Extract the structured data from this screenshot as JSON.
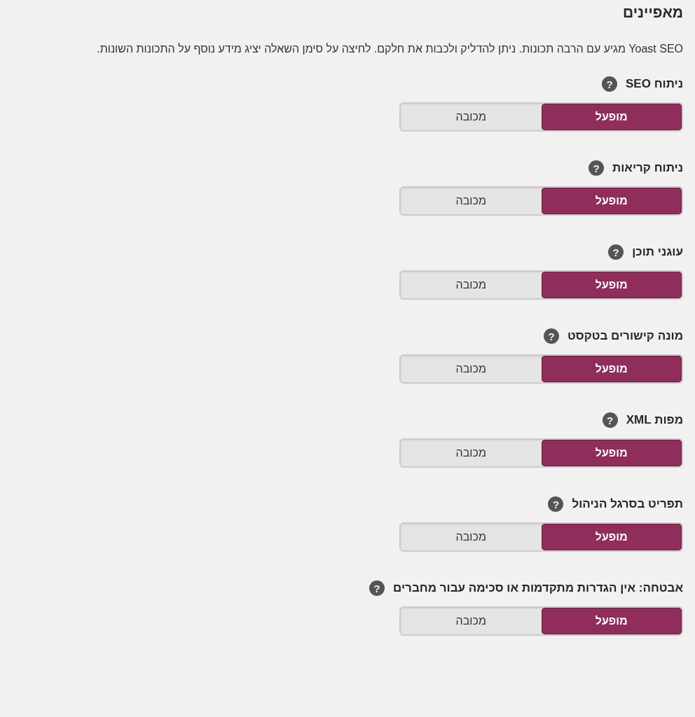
{
  "heading": "מאפיינים",
  "description": "Yoast SEO מגיע עם הרבה תכונות. ניתן להדליק ולכבות את חלקם. לחיצה על סימן השאלה יציג מידע נוסף על התכונות השונות.",
  "features": [
    {
      "label": "ניתוח SEO",
      "help": "?",
      "options": [
        {
          "label": "מופעל",
          "selected": true
        },
        {
          "label": "מכובה",
          "selected": false
        }
      ]
    },
    {
      "label": "ניתוח קריאות",
      "help": "?",
      "options": [
        {
          "label": "מופעל",
          "selected": true
        },
        {
          "label": "מכובה",
          "selected": false
        }
      ]
    },
    {
      "label": "עוגני תוכן",
      "help": "?",
      "options": [
        {
          "label": "מופעל",
          "selected": true
        },
        {
          "label": "מכובה",
          "selected": false
        }
      ]
    },
    {
      "label": "מונה קישורים בטקסט",
      "help": "?",
      "options": [
        {
          "label": "מופעל",
          "selected": true
        },
        {
          "label": "מכובה",
          "selected": false
        }
      ]
    },
    {
      "label": "מפות XML",
      "help": "?",
      "options": [
        {
          "label": "מופעל",
          "selected": true
        },
        {
          "label": "מכובה",
          "selected": false
        }
      ]
    },
    {
      "label": "תפריט בסרגל הניהול",
      "help": "?",
      "options": [
        {
          "label": "מופעל",
          "selected": true
        },
        {
          "label": "מכובה",
          "selected": false
        }
      ]
    },
    {
      "label": "אבטחה: אין הגדרות מתקדמות או סכימה עבור מחברים",
      "help": "?",
      "options": [
        {
          "label": "מופעל",
          "selected": true
        },
        {
          "label": "מכובה",
          "selected": false
        }
      ]
    }
  ]
}
